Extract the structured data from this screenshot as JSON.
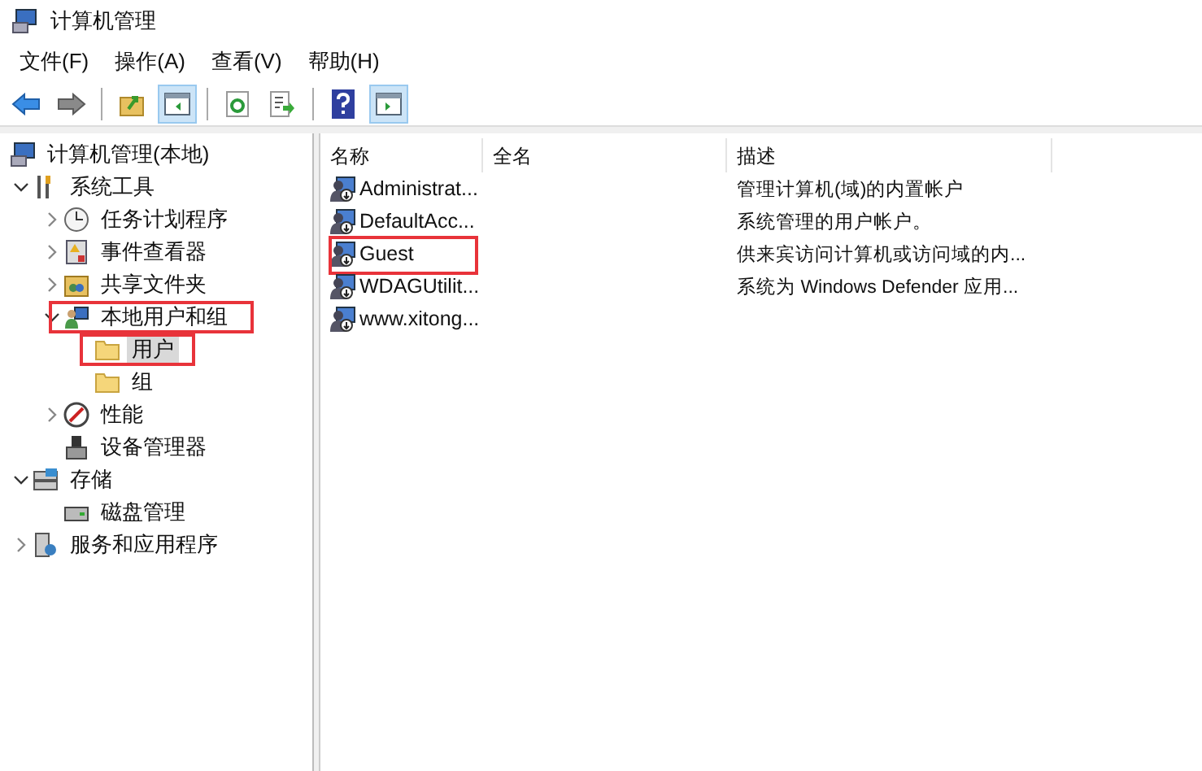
{
  "window": {
    "title": "计算机管理"
  },
  "menu": [
    "文件(F)",
    "操作(A)",
    "查看(V)",
    "帮助(H)"
  ],
  "toolbar": [
    {
      "kind": "back",
      "active": false
    },
    {
      "kind": "forward",
      "active": false
    },
    {
      "kind": "sep"
    },
    {
      "kind": "up",
      "active": false
    },
    {
      "kind": "pane",
      "active": true
    },
    {
      "kind": "sep"
    },
    {
      "kind": "refresh",
      "active": false
    },
    {
      "kind": "export",
      "active": false
    },
    {
      "kind": "sep"
    },
    {
      "kind": "help",
      "active": false
    },
    {
      "kind": "action",
      "active": true
    }
  ],
  "tree": [
    {
      "label": "计算机管理(本地)",
      "selected": false,
      "highlighted": false,
      "children": [
        {
          "label": "系统工具",
          "expanded": true,
          "selected": false,
          "highlighted": false,
          "children": [
            {
              "label": "任务计划程序",
              "expanded": false,
              "selected": false,
              "highlighted": false
            },
            {
              "label": "事件查看器",
              "expanded": false,
              "selected": false,
              "highlighted": false
            },
            {
              "label": "共享文件夹",
              "expanded": false,
              "selected": false,
              "highlighted": false
            },
            {
              "label": "本地用户和组",
              "expanded": true,
              "selected": false,
              "highlighted": true,
              "children": [
                {
                  "label": "用户",
                  "selected": true,
                  "highlighted": true
                },
                {
                  "label": "组",
                  "selected": false,
                  "highlighted": false
                }
              ]
            },
            {
              "label": "性能",
              "expanded": false,
              "selected": false,
              "highlighted": false
            },
            {
              "label": "设备管理器",
              "selected": false,
              "highlighted": false
            }
          ]
        },
        {
          "label": "存储",
          "expanded": true,
          "selected": false,
          "highlighted": false,
          "children": [
            {
              "label": "磁盘管理",
              "selected": false,
              "highlighted": false
            }
          ]
        },
        {
          "label": "服务和应用程序",
          "expanded": false,
          "selected": false,
          "highlighted": false
        }
      ]
    }
  ],
  "table": {
    "columns": [
      "名称",
      "全名",
      "描述"
    ],
    "rows": [
      {
        "name": "Administrat...",
        "description": "管理计算机(域)的内置帐户",
        "highlighted": false
      },
      {
        "name": "DefaultAcc...",
        "description": "系统管理的用户帐户。",
        "highlighted": false
      },
      {
        "name": "Guest",
        "description": "供来宾访问计算机或访问域的内...",
        "highlighted": true
      },
      {
        "name": "WDAGUtilit...",
        "description": "系统为 Windows Defender 应用...",
        "highlighted": false
      },
      {
        "name": "www.xitong...",
        "highlighted": false
      }
    ]
  }
}
